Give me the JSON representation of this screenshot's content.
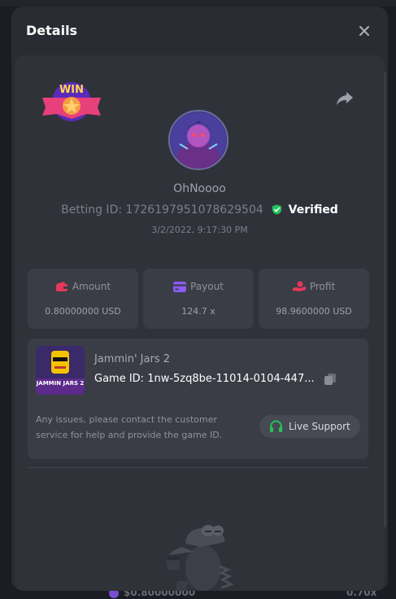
{
  "modal": {
    "title": "Details",
    "close_icon": "close-icon"
  },
  "bet": {
    "badge": "WIN",
    "username": "OhNoooo",
    "betting_id_label": "Betting ID:",
    "betting_id": "1726197951078629504",
    "verified_label": "Verified",
    "datetime": "3/2/2022, 9:17:30 PM"
  },
  "stats": {
    "amount": {
      "label": "Amount",
      "value": "0.80000000 USD",
      "icon": "wallet-icon"
    },
    "payout": {
      "label": "Payout",
      "value": "124.7 x",
      "icon": "card-icon"
    },
    "profit": {
      "label": "Profit",
      "value": "98.9600000 USD",
      "icon": "hand-coin-icon"
    }
  },
  "game": {
    "name": "Jammin' Jars 2",
    "thumb_text": "JAMMIN JARS 2",
    "id_label": "Game ID:",
    "id_value": "1nw-5zq8be-11014-0104-447...",
    "support_note": "Any issues, please contact the customer service for help and provide the game ID.",
    "support_button": "Live Support"
  },
  "background": {
    "left_value": "$0.80000000",
    "right_value": "0.70x"
  },
  "colors": {
    "modal_bg": "#2a2c33",
    "panel_bg": "#30323a",
    "card_bg": "#3a3d46",
    "accent_green": "#22c55e",
    "amount_icon": "#e8375a",
    "payout_icon": "#8b5cf6",
    "profit_icon": "#e8375a"
  }
}
